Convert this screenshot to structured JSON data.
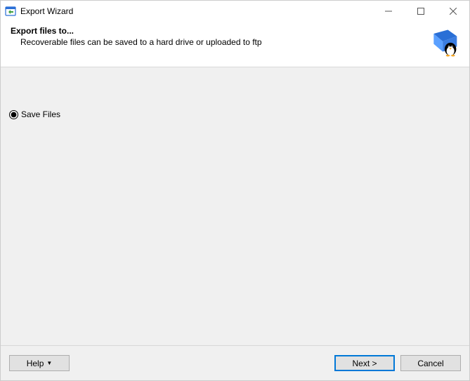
{
  "window": {
    "title": "Export Wizard"
  },
  "header": {
    "title": "Export files to...",
    "subtitle": "Recoverable files can be saved to a hard drive or uploaded to ftp"
  },
  "options": {
    "save_files": {
      "label": "Save Files",
      "checked": true
    }
  },
  "footer": {
    "help": "Help",
    "next": "Next >",
    "cancel": "Cancel"
  }
}
